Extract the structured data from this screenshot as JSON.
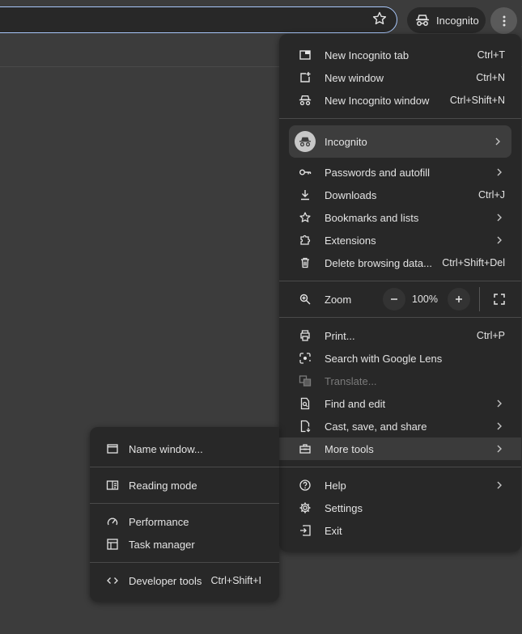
{
  "toolbar": {
    "bookmark_star_icon": "star-outline-icon",
    "incognito_chip_label": "Incognito",
    "menu_icon": "three-dot-vertical-icon"
  },
  "menu": {
    "new_incognito_tab": {
      "label": "New Incognito tab",
      "shortcut": "Ctrl+T"
    },
    "new_window": {
      "label": "New window",
      "shortcut": "Ctrl+N"
    },
    "new_incognito_window": {
      "label": "New Incognito window",
      "shortcut": "Ctrl+Shift+N"
    },
    "profile": {
      "label": "Incognito"
    },
    "passwords": {
      "label": "Passwords and autofill"
    },
    "downloads": {
      "label": "Downloads",
      "shortcut": "Ctrl+J"
    },
    "bookmarks": {
      "label": "Bookmarks and lists"
    },
    "extensions": {
      "label": "Extensions"
    },
    "delete_data": {
      "label": "Delete browsing data...",
      "shortcut": "Ctrl+Shift+Del"
    },
    "zoom": {
      "label": "Zoom",
      "value": "100%",
      "minus": "−",
      "plus": "+"
    },
    "print": {
      "label": "Print...",
      "shortcut": "Ctrl+P"
    },
    "lens": {
      "label": "Search with Google Lens"
    },
    "translate": {
      "label": "Translate..."
    },
    "find_edit": {
      "label": "Find and edit"
    },
    "cast_save": {
      "label": "Cast, save, and share"
    },
    "more_tools": {
      "label": "More tools"
    },
    "help": {
      "label": "Help"
    },
    "settings": {
      "label": "Settings"
    },
    "exit": {
      "label": "Exit"
    }
  },
  "submenu": {
    "name_window": {
      "label": "Name window..."
    },
    "reading_mode": {
      "label": "Reading mode"
    },
    "performance": {
      "label": "Performance"
    },
    "task_manager": {
      "label": "Task manager"
    },
    "developer_tools": {
      "label": "Developer tools",
      "shortcut": "Ctrl+Shift+I"
    }
  },
  "colors": {
    "menu_bg": "#282828",
    "page_bg": "#3c3c3c",
    "highlight": "#3b3b3b",
    "omnibox_border": "#a8c7fa",
    "text": "#e3e3e3",
    "disabled_text": "#7a7a7a"
  }
}
